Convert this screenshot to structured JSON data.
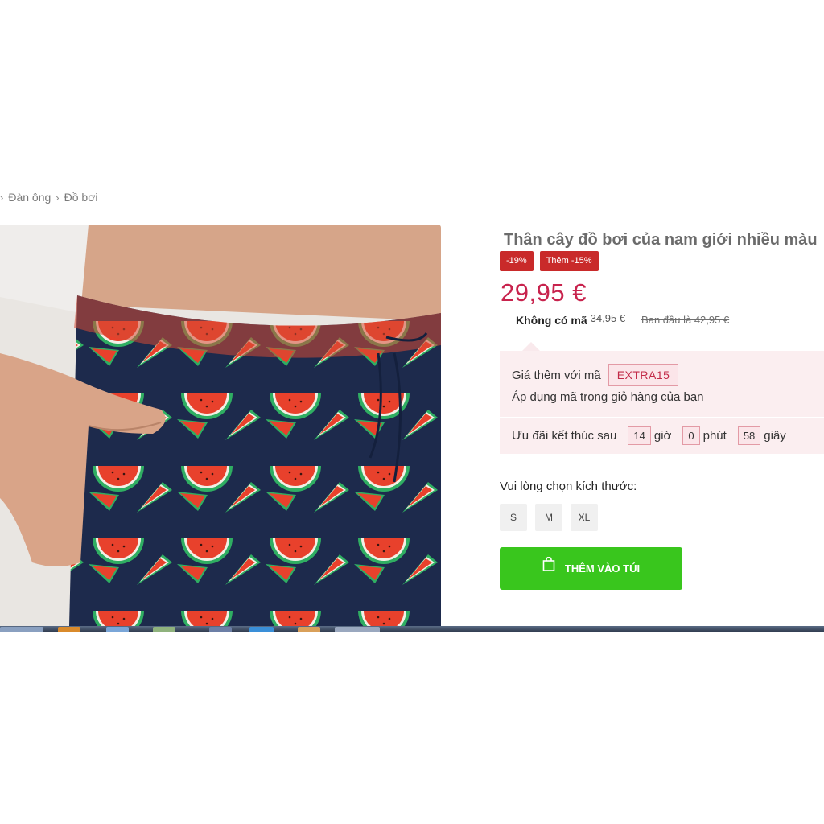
{
  "breadcrumb": {
    "items": [
      "Đàn ông",
      "Đồ bơi"
    ]
  },
  "product": {
    "title": "Thân cây đồ bơi của nam giới nhiều màu",
    "badges": [
      "-19%",
      "Thêm -15%"
    ],
    "price": "29,95 €",
    "no_code_label": "Không có mã",
    "no_code_price": "34,95 €",
    "original_price": "Ban đầu là 42,95 €"
  },
  "promo": {
    "extra_label": "Giá thêm với mã",
    "code": "EXTRA15",
    "apply_text": "Áp dụng mã trong giỏ hàng của bạn",
    "offer_ends_label": "Ưu đãi kết thúc sau",
    "hours": "14",
    "hours_unit": "giờ",
    "minutes": "0",
    "minutes_unit": "phút",
    "seconds": "58",
    "seconds_unit": "giây"
  },
  "size": {
    "label": "Vui lòng chọn kích thước:",
    "options": [
      "S",
      "M",
      "XL"
    ]
  },
  "cart": {
    "add_label": "THÊM VÀO TÚI"
  },
  "colors": {
    "price": "#c8234d",
    "badge": "#c92a2a",
    "add_button": "#39c61d",
    "promo_bg": "#fbeef0"
  },
  "icons": {
    "breadcrumb_separator": "chevron-right-icon",
    "add_to_bag": "shopping-bag-icon"
  }
}
